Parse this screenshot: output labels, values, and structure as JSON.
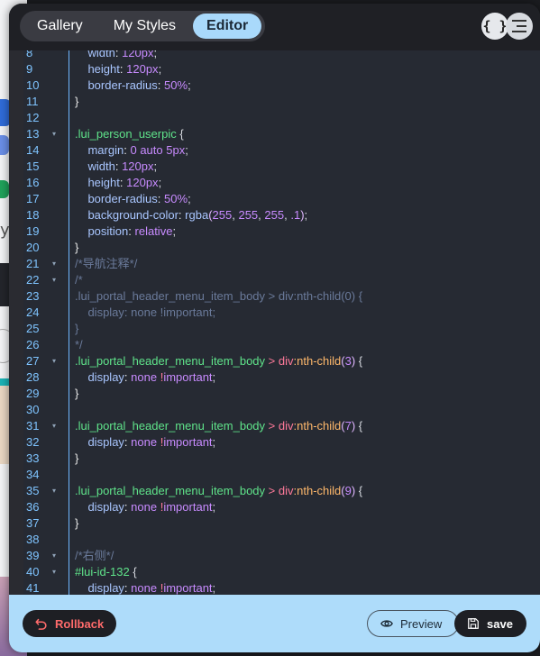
{
  "tabs": [
    {
      "label": "Gallery",
      "active": false
    },
    {
      "label": "My Styles",
      "active": false
    },
    {
      "label": "Editor",
      "active": true
    }
  ],
  "toolbar_icons": [
    "braces-icon",
    "outline-icon"
  ],
  "gutter": {
    "lines": [
      "8",
      "9",
      "10",
      "11",
      "12",
      "13",
      "14",
      "15",
      "16",
      "17",
      "18",
      "19",
      "20",
      "21",
      "22",
      "23",
      "24",
      "25",
      "26",
      "27",
      "28",
      "29",
      "30",
      "31",
      "32",
      "33",
      "34",
      "35",
      "36",
      "37",
      "38",
      "39",
      "40",
      "41"
    ]
  },
  "code": [
    "    width: 120px;",
    "    height: 120px;",
    "    border-radius: 50%;",
    "}",
    "",
    ".lui_person_userpic {",
    "    margin: 0 auto 5px;",
    "    width: 120px;",
    "    height: 120px;",
    "    border-radius: 50%;",
    "    background-color: rgba(255, 255, 255, .1);",
    "    position: relative;",
    "}",
    "/*导航注释*/",
    "/*",
    ".lui_portal_header_menu_item_body > div:nth-child(0) {",
    "    display: none !important;",
    "}",
    "*/",
    ".lui_portal_header_menu_item_body > div:nth-child(3) {",
    "    display: none !important;",
    "}",
    "",
    ".lui_portal_header_menu_item_body > div:nth-child(7) {",
    "    display: none !important;",
    "}",
    "",
    ".lui_portal_header_menu_item_body > div:nth-child(9) {",
    "    display: none !important;",
    "}",
    "",
    "/*右侧*/",
    "#lui-id-132 {",
    "    display: none !important;"
  ],
  "folded_lines": [
    "13",
    "21",
    "22",
    "27",
    "31",
    "35",
    "39",
    "40"
  ],
  "footer": {
    "rollback_label": "Rollback",
    "preview_label": "Preview",
    "save_label": "save"
  },
  "colors": {
    "accent": "#a9d9fb",
    "footer_bg": "#aedcfa",
    "rollback_text": "#ff6b6b",
    "selector": "#5fe38a",
    "property": "#a9c6ff",
    "value": "#c88bff",
    "line_number": "#7fc4ff"
  }
}
